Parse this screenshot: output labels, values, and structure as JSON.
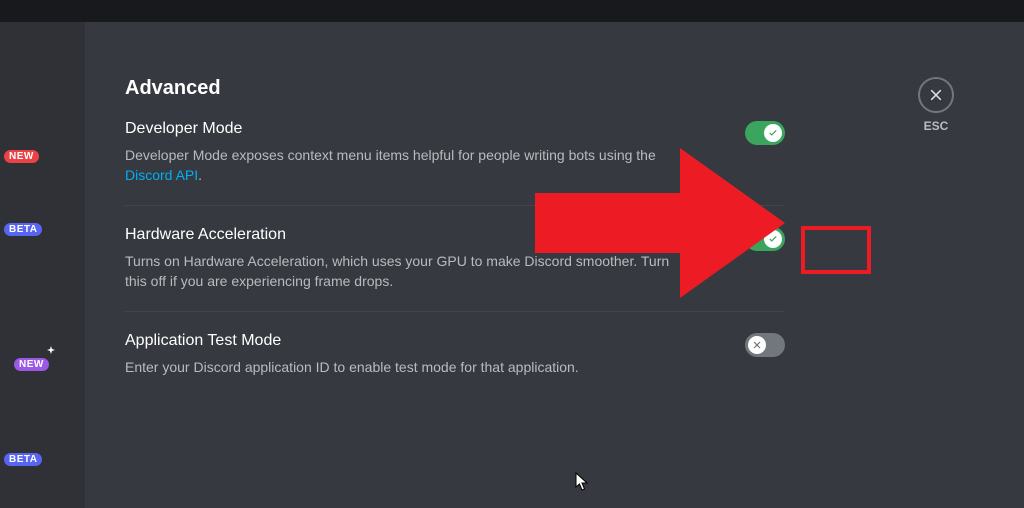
{
  "sidebar": {
    "badges": [
      {
        "text": "NEW",
        "class": "badge-new"
      },
      {
        "text": "BETA",
        "class": "badge-beta"
      },
      {
        "text": "NEW",
        "class": "badge-new-purple",
        "sparkle": true
      },
      {
        "text": "BETA",
        "class": "badge-beta"
      }
    ]
  },
  "page": {
    "title": "Advanced"
  },
  "close": {
    "label": "ESC"
  },
  "settings": [
    {
      "title": "Developer Mode",
      "desc_pre": "Developer Mode exposes context menu items helpful for people writing bots using the ",
      "link_text": "Discord API",
      "desc_post": ".",
      "toggle_on": true
    },
    {
      "title": "Hardware Acceleration",
      "desc_pre": "Turns on Hardware Acceleration, which uses your GPU to make Discord smoother. Turn this off if you are experiencing frame drops.",
      "link_text": "",
      "desc_post": "",
      "toggle_on": true
    },
    {
      "title": "Application Test Mode",
      "desc_pre": "Enter your Discord application ID to enable test mode for that application.",
      "link_text": "",
      "desc_post": "",
      "toggle_on": false
    }
  ],
  "annotation": {
    "arrow_color": "#ed1c24",
    "box_color": "#ed1c24"
  }
}
